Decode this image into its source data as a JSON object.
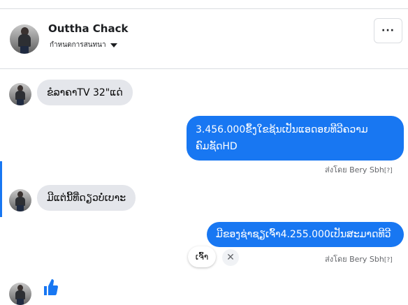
{
  "header": {
    "contact_name": "Outtha Chack",
    "subtitle": "กำหนดการสนทนา",
    "more_label": "···"
  },
  "messages": [
    {
      "direction": "in",
      "text": "ຂໍລາຄາTV 32\"ແດ່"
    },
    {
      "direction": "out",
      "text_line1": "3.456.000ຂຶ້ງໃຂຊ້ນເປັນແອດອຍທີວີຄວາມ",
      "text_line2": "ຄົມຊັດHD",
      "status": "ส่งโดย Bery Sbh",
      "status_mark": "[?]"
    },
    {
      "direction": "in",
      "text": "ມີແຕ່ນີ້ທີ່ດຽວບໍ່ເບາະ"
    },
    {
      "direction": "out",
      "text": "ມີຂອງຊ່າຊຽເຈົ້າ4.255.000ເປັນສະມາດທີວີ",
      "status": "ส่งโดย Bery Sbh",
      "status_mark": "[?]"
    }
  ],
  "quick_reply": {
    "label": "ເຈົ້າ",
    "close": "✕"
  },
  "colors": {
    "accent": "#1877f2",
    "incoming_bubble": "#e4e6eb"
  },
  "icons": [
    "more-options-icon",
    "caret-down-icon",
    "thumbs-up-icon",
    "close-icon"
  ]
}
